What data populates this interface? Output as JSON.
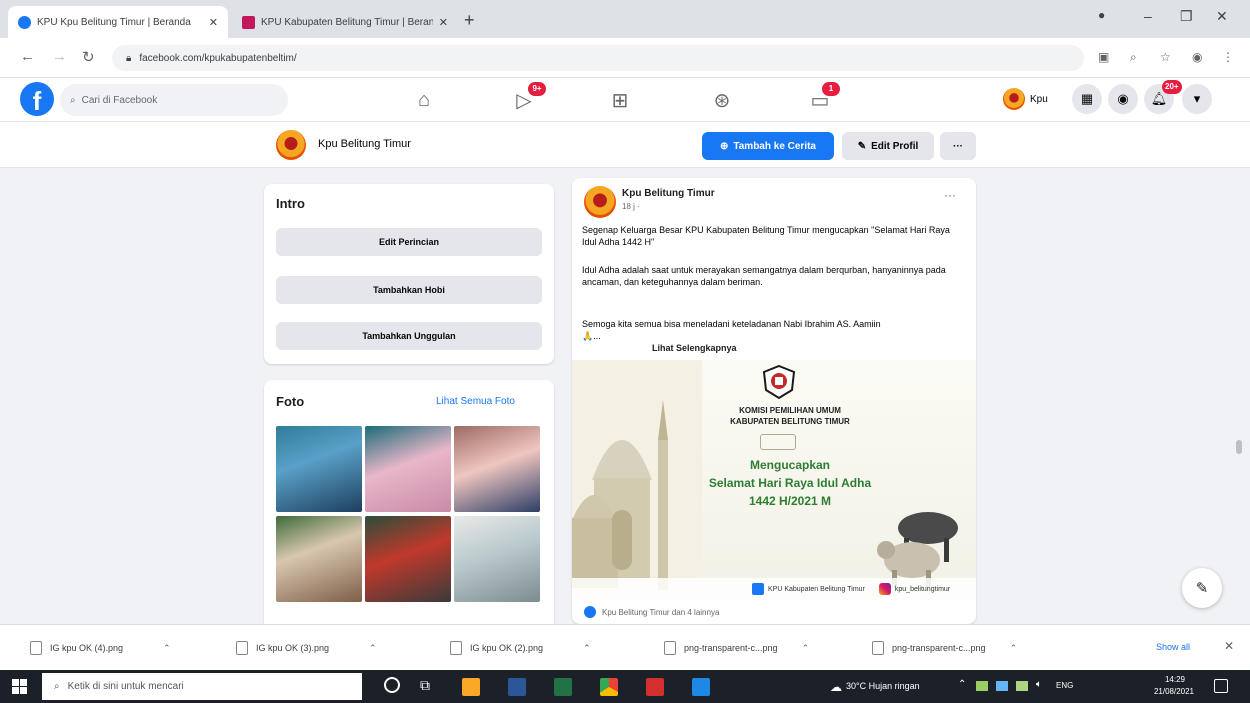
{
  "browser": {
    "tabs": [
      {
        "label": "KPU Kpu Belitung Timur | Beranda",
        "active": true,
        "color": "#1877f2"
      },
      {
        "label": "KPU Kabupaten Belitung Timur | Beranda",
        "active": false,
        "color": "#c2185b"
      }
    ],
    "new_tab_label": "+",
    "address": "facebook.com/kpukabupatenbeltim/",
    "window_controls": [
      "–",
      "❐",
      "✕"
    ]
  },
  "facebook": {
    "search_placeholder": "Cari di Facebook",
    "nav_badges": {
      "watch": "9+",
      "gaming": "1"
    },
    "profile_name": "Kpu",
    "messenger_badge": "20+"
  },
  "page_header": {
    "name": "Kpu Belitung Timur",
    "add_story_label": "Tambah ke Cerita",
    "edit_profile_label": "Edit Profil",
    "more_label": "···"
  },
  "intro": {
    "title": "Intro",
    "buttons": [
      "Edit Perincian",
      "Tambahkan Hobi",
      "Tambahkan Unggulan"
    ]
  },
  "photos": {
    "title": "Foto",
    "see_all": "Lihat Semua Foto"
  },
  "post": {
    "author": "Kpu Belitung Timur",
    "time": "18 j ·",
    "paragraph1": "Segenap Keluarga Besar KPU Kabupaten Belitung Timur mengucapkan \"Selamat Hari Raya Idul Adha 1442 H\"",
    "paragraph2": "Idul Adha adalah saat untuk merayakan semangatnya dalam berqurban, hanyaninnya pada ancaman, dan keteguhannya dalam beriman.",
    "paragraph3": "Semoga kita semua bisa meneladani keteladanan Nabi Ibrahim AS. Aamiin 🙏...",
    "see_more": "Lihat Selengkapnya",
    "more_label": "···",
    "image": {
      "org_line1": "KOMISI PEMILIHAN UMUM",
      "org_line2": "KABUPATEN BELITUNG TIMUR",
      "greeting": "Mengucapkan",
      "line1": "Selamat Hari Raya Idul Adha",
      "line2": "1442 H/2021 M",
      "social_fb": "KPU Kabupaten Belitung Timur",
      "social_ig": "kpu_belitungtimur"
    },
    "reactions_text": "Kpu Belitung Timur dan 4 lainnya"
  },
  "downloads": [
    {
      "name": "IG kpu OK (4).png"
    },
    {
      "name": "IG kpu OK (3).png"
    },
    {
      "name": "IG kpu OK (2).png"
    },
    {
      "name": "png-transparent-c...png"
    },
    {
      "name": "png-transparent-c...png"
    }
  ],
  "show_all": "Show all",
  "taskbar": {
    "search_placeholder": "Ketik di sini untuk mencari",
    "weather": "30°C Hujan ringan",
    "time": "14:29",
    "date": "21/08/2021",
    "lang": "ENG"
  }
}
